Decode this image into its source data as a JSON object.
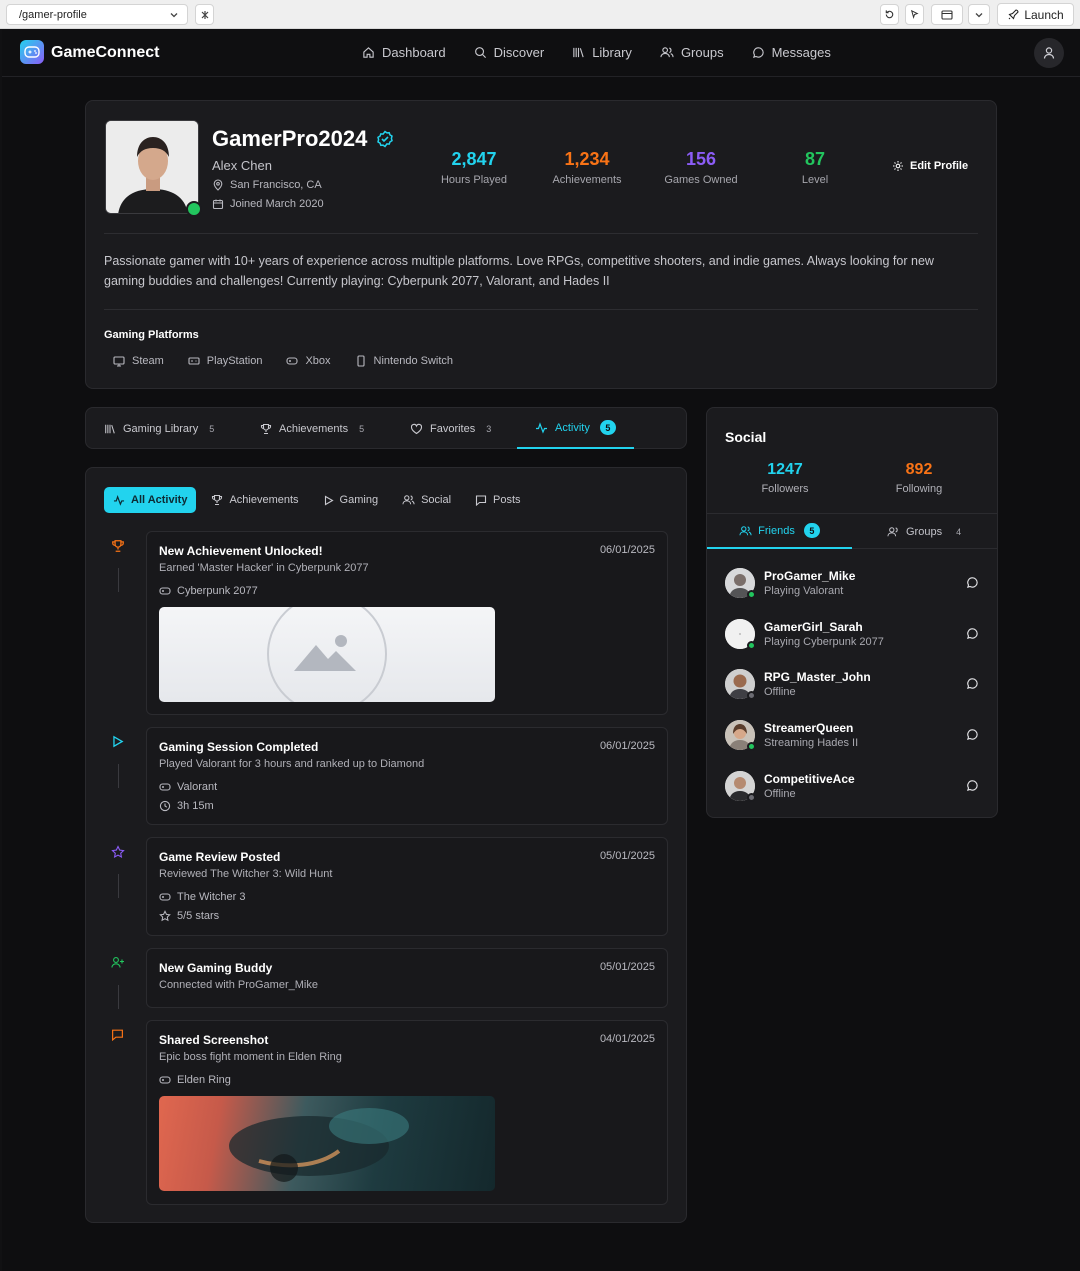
{
  "browser": {
    "url": "/gamer-profile",
    "launch_label": "Launch"
  },
  "nav": {
    "brand": "GameConnect",
    "links": [
      {
        "label": "Dashboard",
        "icon": "home-icon"
      },
      {
        "label": "Discover",
        "icon": "search-icon"
      },
      {
        "label": "Library",
        "icon": "library-icon"
      },
      {
        "label": "Groups",
        "icon": "users-icon"
      },
      {
        "label": "Messages",
        "icon": "message-icon"
      }
    ]
  },
  "profile": {
    "username": "GamerPro2024",
    "real_name": "Alex Chen",
    "location": "San Francisco, CA",
    "joined": "Joined March 2020",
    "status": "online",
    "stats": [
      {
        "value": "2,847",
        "label": "Hours Played",
        "color": "#22d3ee"
      },
      {
        "value": "1,234",
        "label": "Achievements",
        "color": "#f97316"
      },
      {
        "value": "156",
        "label": "Games Owned",
        "color": "#8b5cf6"
      },
      {
        "value": "87",
        "label": "Level",
        "color": "#22c55e"
      }
    ],
    "edit_label": "Edit Profile",
    "bio": "Passionate gamer with 10+ years of experience across multiple platforms. Love RPGs, competitive shooters, and indie games. Always looking for new gaming buddies and challenges! Currently playing: Cyberpunk 2077, Valorant, and Hades II",
    "platforms_heading": "Gaming Platforms",
    "platforms": [
      "Steam",
      "PlayStation",
      "Xbox",
      "Nintendo Switch"
    ]
  },
  "tabs": [
    {
      "label": "Gaming Library",
      "count": "5"
    },
    {
      "label": "Achievements",
      "count": "5"
    },
    {
      "label": "Favorites",
      "count": "3"
    },
    {
      "label": "Activity",
      "count": "5"
    }
  ],
  "filters": [
    "All Activity",
    "Achievements",
    "Gaming",
    "Social",
    "Posts"
  ],
  "activities": [
    {
      "title": "New Achievement Unlocked!",
      "date": "06/01/2025",
      "desc": "Earned 'Master Hacker' in Cyberpunk 2077",
      "game": "Cyberpunk 2077",
      "icon": "trophy-icon"
    },
    {
      "title": "Gaming Session Completed",
      "date": "06/01/2025",
      "desc": "Played Valorant for 3 hours and ranked up to Diamond",
      "game": "Valorant",
      "extra": "3h 15m",
      "icon": "play-icon"
    },
    {
      "title": "Game Review Posted",
      "date": "05/01/2025",
      "desc": "Reviewed The Witcher 3: Wild Hunt",
      "game": "The Witcher 3",
      "extra": "5/5 stars",
      "icon": "star-icon"
    },
    {
      "title": "New Gaming Buddy",
      "date": "05/01/2025",
      "desc": "Connected with ProGamer_Mike",
      "icon": "user-plus-icon"
    },
    {
      "title": "Shared Screenshot",
      "date": "04/01/2025",
      "desc": "Epic boss fight moment in Elden Ring",
      "game": "Elden Ring",
      "icon": "comment-icon"
    }
  ],
  "social": {
    "title": "Social",
    "followers": {
      "value": "1247",
      "label": "Followers"
    },
    "following": {
      "value": "892",
      "label": "Following"
    },
    "tabs": [
      {
        "label": "Friends",
        "count": "5"
      },
      {
        "label": "Groups",
        "count": "4"
      }
    ],
    "friends": [
      {
        "name": "ProGamer_Mike",
        "status": "Playing Valorant",
        "online": true
      },
      {
        "name": "GamerGirl_Sarah",
        "status": "Playing Cyberpunk 2077",
        "online": true
      },
      {
        "name": "RPG_Master_John",
        "status": "Offline",
        "online": false
      },
      {
        "name": "StreamerQueen",
        "status": "Streaming Hades II",
        "online": true
      },
      {
        "name": "CompetitiveAce",
        "status": "Offline",
        "online": false
      }
    ]
  }
}
